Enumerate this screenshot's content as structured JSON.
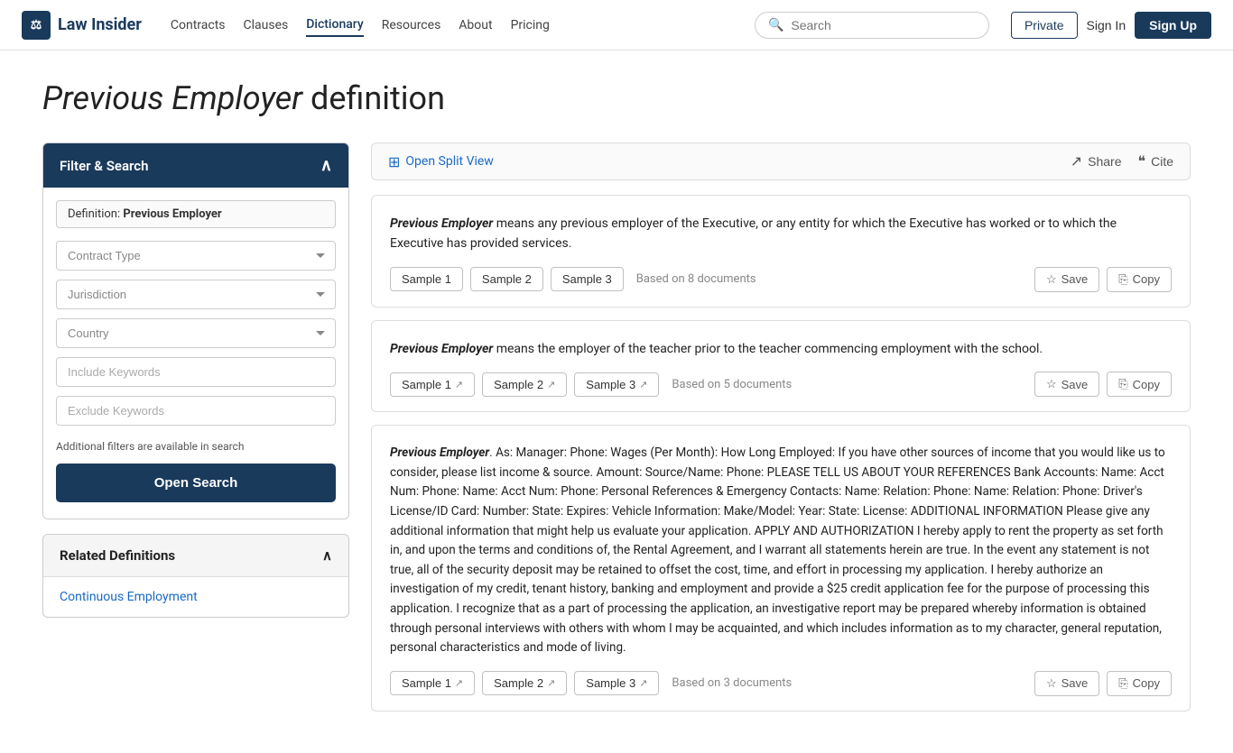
{
  "navbar": {
    "logo_text": "Law Insider",
    "nav_items": [
      {
        "label": "Contracts",
        "active": false
      },
      {
        "label": "Clauses",
        "active": false
      },
      {
        "label": "Dictionary",
        "active": true
      },
      {
        "label": "Resources",
        "active": false
      },
      {
        "label": "About",
        "active": false
      },
      {
        "label": "Pricing",
        "active": false
      }
    ],
    "search_placeholder": "Search",
    "btn_private": "Private",
    "btn_signin": "Sign In",
    "btn_signup": "Sign Up"
  },
  "page_title_italic": "Previous Employer",
  "page_title_normal": " definition",
  "filter": {
    "header": "Filter & Search",
    "definition_label": "Definition:",
    "definition_value": "Previous Employer",
    "contract_type_placeholder": "Contract Type",
    "jurisdiction_placeholder": "Jurisdiction",
    "country_placeholder": "Country",
    "include_keywords_placeholder": "Include Keywords",
    "exclude_keywords_placeholder": "Exclude Keywords",
    "additional_note": "Additional filters are available in search",
    "open_search_btn": "Open Search"
  },
  "related": {
    "header": "Related Definitions",
    "link": "Continuous Employment"
  },
  "toolbar": {
    "split_view_label": "Open Split View",
    "share_label": "Share",
    "cite_label": "Cite"
  },
  "definitions": [
    {
      "id": 1,
      "term": "Previous Employer",
      "text": " means any previous employer of the Executive, or any entity for which the Executive has worked or to which the Executive has provided services.",
      "samples": [
        "Sample 1",
        "Sample 2",
        "Sample 3"
      ],
      "sample_links": [
        false,
        false,
        false
      ],
      "based_on": "Based on 8 documents",
      "save_label": "Save",
      "copy_label": "Copy"
    },
    {
      "id": 2,
      "term": "Previous Employer",
      "text": " means the employer of the teacher prior to the teacher commencing employment with the school.",
      "samples": [
        "Sample 1",
        "Sample 2",
        "Sample 3"
      ],
      "sample_links": [
        true,
        true,
        true
      ],
      "based_on": "Based on 5 documents",
      "save_label": "Save",
      "copy_label": "Copy"
    },
    {
      "id": 3,
      "term": "Previous Employer",
      "text": ". As: Manager: Phone: Wages (Per Month): How Long Employed: If you have other sources of income that you would like us to consider, please list income & source. Amount: Source/Name: Phone: PLEASE TELL US ABOUT YOUR REFERENCES Bank Accounts: Name: Acct Num: Phone: Name: Acct Num: Phone: Personal References & Emergency Contacts: Name: Relation: Phone: Name: Relation: Phone: Driver's License/ID Card: Number: State: Expires: Vehicle Information: Make/Model: Year: State: License: ADDITIONAL INFORMATION Please give any additional information that might help us evaluate your application. APPLY AND AUTHORIZATION I hereby apply to rent the property as set forth in, and upon the terms and conditions of, the Rental Agreement, and I warrant all statements herein are true. In the event any statement is not true, all of the security deposit may be retained to offset the cost, time, and effort in processing my application. I hereby authorize an investigation of my credit, tenant history, banking and employment and provide a $25 credit application fee for the purpose of processing this application. I recognize that as a part of processing the application, an investigative report may be prepared whereby information is obtained through personal interviews with others with whom I may be acquainted, and which includes information as to my character, general reputation, personal characteristics and mode of living.",
      "samples": [
        "Sample 1",
        "Sample 2",
        "Sample 3"
      ],
      "sample_links": [
        true,
        true,
        true
      ],
      "based_on": "Based on 3 documents",
      "save_label": "Save",
      "copy_label": "Copy"
    }
  ]
}
